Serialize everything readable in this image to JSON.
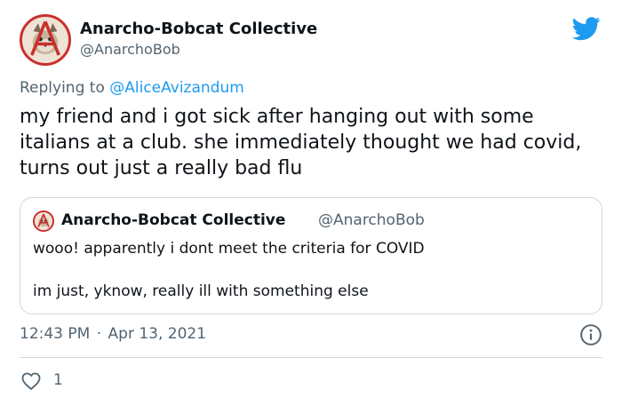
{
  "tweet": {
    "author_name": "Anarcho-Bobcat Collective",
    "author_handle": "@AnarchoBob",
    "replying_prefix": "Replying to",
    "replying_to": "@AliceAvizandum",
    "text": "my friend and i got sick after hanging out with some italians at a club. she immediately thought we had covid, turns out just a really bad flu",
    "time": "12:43 PM",
    "separator": "·",
    "date": "Apr 13, 2021",
    "like_count": "1"
  },
  "quote": {
    "author_name": "Anarcho-Bobcat Collective",
    "author_handle": "@AnarchoBob",
    "line1": "wooo! apparently i dont meet the criteria for COVID",
    "line2": "im just, yknow, really ill with something else"
  },
  "colors": {
    "accent": "#1d9bf0",
    "secondary_text": "#536471",
    "avatar_ring": "#c9302c"
  },
  "icons": {
    "brand": "twitter-bird-icon",
    "info": "info-icon",
    "like": "heart-outline-icon"
  }
}
